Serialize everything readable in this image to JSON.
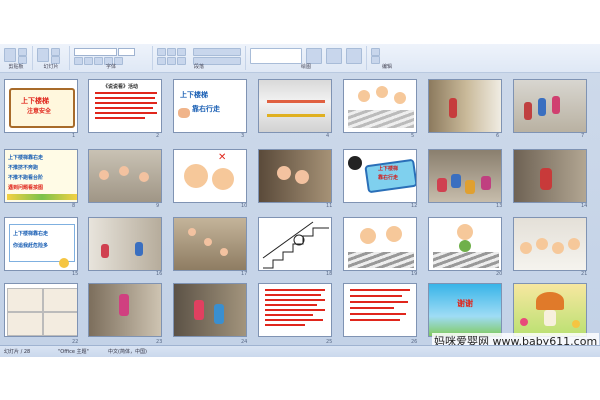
{
  "app": {
    "ribbon_groups": [
      {
        "label": "剪贴板"
      },
      {
        "label": "幻灯片"
      },
      {
        "label": "字体"
      },
      {
        "label": "段落"
      },
      {
        "label": "绘图"
      },
      {
        "label": "编辑"
      }
    ],
    "font_combo": "",
    "size_combo": ""
  },
  "slides": [
    {
      "num": "1",
      "title": "上下楼梯",
      "subtitle": "注意安全"
    },
    {
      "num": "2",
      "title": "《说说看》活动"
    },
    {
      "num": "3",
      "title": "上下楼梯",
      "subtitle": "靠右行走"
    },
    {
      "num": "4"
    },
    {
      "num": "5"
    },
    {
      "num": "6"
    },
    {
      "num": "7"
    },
    {
      "num": "8",
      "lines": [
        "上下楼梯靠右走",
        "不推挤不奔跑",
        "不推不跑看台阶",
        "遇到问题看孩图"
      ]
    },
    {
      "num": "9"
    },
    {
      "num": "10"
    },
    {
      "num": "11"
    },
    {
      "num": "12",
      "title": "上下楼梯",
      "subtitle": "靠右行走"
    },
    {
      "num": "13"
    },
    {
      "num": "14"
    },
    {
      "num": "15",
      "lines": [
        "上下楼梯靠右走",
        "你追我赶危险多"
      ]
    },
    {
      "num": "16"
    },
    {
      "num": "17"
    },
    {
      "num": "18"
    },
    {
      "num": "19"
    },
    {
      "num": "20"
    },
    {
      "num": "21"
    },
    {
      "num": "22"
    },
    {
      "num": "23"
    },
    {
      "num": "24"
    },
    {
      "num": "25"
    },
    {
      "num": "26"
    },
    {
      "num": "27",
      "title": "谢谢"
    },
    {
      "num": "28"
    }
  ],
  "status": {
    "left": "幻灯片 / 28",
    "theme": "\"Office 主题\"",
    "lang": "中文(简体，中国)"
  },
  "watermark": "妈咪爱婴网 www.baby611.com",
  "colors": {
    "workspace": "#c7d5e9",
    "ribbon": "#dfe8f5",
    "title_red": "#e0261c",
    "title_blue": "#1a5fb4"
  }
}
